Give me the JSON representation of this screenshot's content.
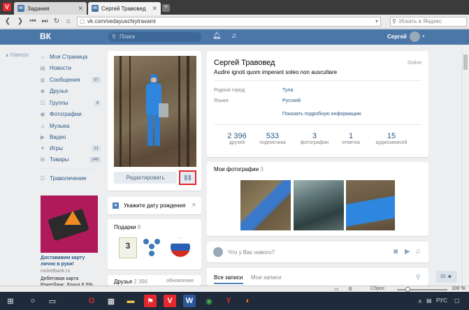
{
  "browser": {
    "tabs": [
      {
        "label": "Задания",
        "favicon": "vk"
      },
      {
        "label": "Сергей Травовед",
        "favicon": "vk"
      }
    ],
    "url": "vk.com/vedayuschiytravami",
    "search_placeholder": "Искать в Яндекс"
  },
  "vk_header": {
    "logo": "ВК",
    "search_placeholder": "Поиск",
    "user_name": "Сергей"
  },
  "sidebar": {
    "back_label": "Наверх",
    "items": [
      {
        "label": "Моя Страница",
        "icon": "home-icon",
        "count": ""
      },
      {
        "label": "Новости",
        "icon": "news-icon",
        "count": ""
      },
      {
        "label": "Сообщения",
        "icon": "messages-icon",
        "count": "57"
      },
      {
        "label": "Друзья",
        "icon": "friends-icon",
        "count": ""
      },
      {
        "label": "Группы",
        "icon": "groups-icon",
        "count": "4"
      },
      {
        "label": "Фотографии",
        "icon": "photos-icon",
        "count": ""
      },
      {
        "label": "Музыка",
        "icon": "music-icon",
        "count": ""
      },
      {
        "label": "Видео",
        "icon": "video-icon",
        "count": ""
      },
      {
        "label": "Игры",
        "icon": "games-icon",
        "count": "21"
      },
      {
        "label": "Товары",
        "icon": "goods-icon",
        "count": "246"
      }
    ],
    "extra_item": "Траволечение",
    "ad": {
      "title": "Достававим карту лично в руки!",
      "domain": "rocketbank.ru",
      "text": "Дебетовая карта Рокетбанк: Доход 6.5%"
    }
  },
  "profile": {
    "edit_button": "Редактировать",
    "birthday_prompt": "Укажите дату рождения",
    "gifts_label": "Подарки",
    "gifts_count": "8",
    "friends_label": "Друзья",
    "friends_count": "2 396",
    "friends_updates": "обновления",
    "name": "Сергей Травовед",
    "status": "Audire ignoti quom imperant soleo non auscultare",
    "online": "Online",
    "fields": [
      {
        "label": "Родной город:",
        "value": "Тула"
      },
      {
        "label": "Языки:",
        "value": "Русский"
      }
    ],
    "more_info": "Показать подробную информацию",
    "counters": [
      {
        "value": "2 396",
        "label": "друзей"
      },
      {
        "value": "533",
        "label": "подписчика"
      },
      {
        "value": "3",
        "label": "фотографии"
      },
      {
        "value": "1",
        "label": "отметка"
      },
      {
        "value": "15",
        "label": "аудиозаписей"
      }
    ],
    "my_photos_label": "Мои фотографии",
    "my_photos_count": "3",
    "post_placeholder": "Что у Вас нового?",
    "wall_tabs": [
      "Все записи",
      "Мои записи"
    ]
  },
  "statusbar": {
    "zoom": "100 %",
    "reset": "Сброс"
  },
  "taskbar": {
    "lang": "РУС",
    "chat_count": "32"
  }
}
